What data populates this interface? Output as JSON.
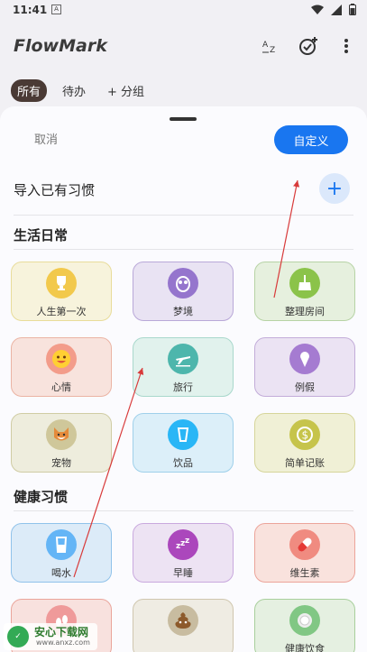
{
  "status": {
    "time": "11:41",
    "indicator": "A"
  },
  "app": {
    "title": "FlowMark"
  },
  "filters": [
    {
      "label": "所有",
      "active": true
    },
    {
      "label": "待办",
      "active": false
    },
    {
      "label": "+ 分组",
      "active": false
    }
  ],
  "sheet": {
    "cancel_label": "取消",
    "custom_label": "自定义",
    "import_label": "导入已有习惯",
    "add_symbol": "+"
  },
  "sections": {
    "life": "生活日常",
    "health": "健康习惯"
  },
  "cards": [
    {
      "label": "人生第一次",
      "icon": "trophy-icon"
    },
    {
      "label": "梦境",
      "icon": "owl-icon"
    },
    {
      "label": "整理房间",
      "icon": "broom-icon"
    },
    {
      "label": "心情",
      "icon": "smile-icon"
    },
    {
      "label": "旅行",
      "icon": "plane-icon"
    },
    {
      "label": "例假",
      "icon": "icecream-icon"
    },
    {
      "label": "宠物",
      "icon": "dog-icon"
    },
    {
      "label": "饮品",
      "icon": "cup-icon"
    },
    {
      "label": "简单记账",
      "icon": "coin-icon"
    },
    {
      "label": "喝水",
      "icon": "glass-icon"
    },
    {
      "label": "早睡",
      "icon": "sleep-icon"
    },
    {
      "label": "维生素",
      "icon": "pill-icon"
    },
    {
      "label": "",
      "icon": "footprint-icon"
    },
    {
      "label": "",
      "icon": "poop-icon"
    },
    {
      "label": "健康饮食",
      "icon": "plate-icon"
    }
  ],
  "watermark": {
    "title": "安心下载网",
    "sub": "www.anxz.com"
  },
  "colors": {
    "primary": "#1976f0",
    "chip_active": "#4a3a35",
    "arrow": "#d83a3a"
  }
}
